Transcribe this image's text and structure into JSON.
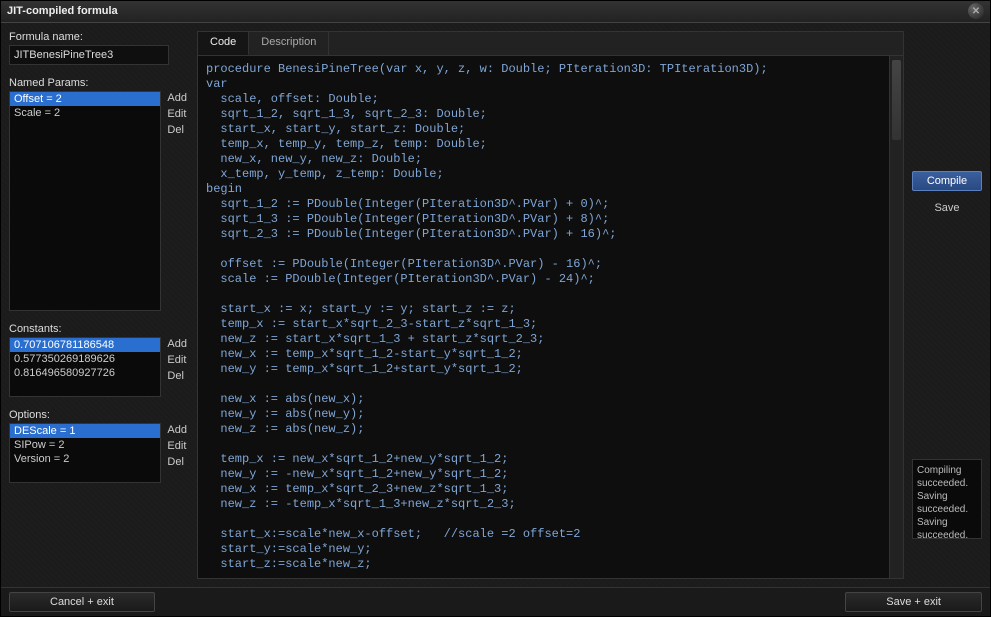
{
  "window": {
    "title": "JIT-compiled formula"
  },
  "formula": {
    "name_label": "Formula name:",
    "name_value": "JITBenesiPineTree3"
  },
  "params": {
    "label": "Named Params:",
    "items": [
      {
        "text": "Offset = 2",
        "selected": true
      },
      {
        "text": "Scale = 2",
        "selected": false
      }
    ],
    "add": "Add",
    "edit": "Edit",
    "del": "Del"
  },
  "constants": {
    "label": "Constants:",
    "items": [
      {
        "text": "0.707106781186548",
        "selected": true
      },
      {
        "text": "0.577350269189626",
        "selected": false
      },
      {
        "text": "0.816496580927726",
        "selected": false
      }
    ],
    "add": "Add",
    "edit": "Edit",
    "del": "Del"
  },
  "options": {
    "label": "Options:",
    "items": [
      {
        "text": "DEScale = 1",
        "selected": true
      },
      {
        "text": "SIPow = 2",
        "selected": false
      },
      {
        "text": "Version = 2",
        "selected": false
      }
    ],
    "add": "Add",
    "edit": "Edit",
    "del": "Del"
  },
  "tabs": {
    "code": "Code",
    "description": "Description"
  },
  "code": "procedure BenesiPineTree(var x, y, z, w: Double; PIteration3D: TPIteration3D);\nvar\n  scale, offset: Double;\n  sqrt_1_2, sqrt_1_3, sqrt_2_3: Double;\n  start_x, start_y, start_z: Double;\n  temp_x, temp_y, temp_z, temp: Double;\n  new_x, new_y, new_z: Double;\n  x_temp, y_temp, z_temp: Double;\nbegin\n  sqrt_1_2 := PDouble(Integer(PIteration3D^.PVar) + 0)^;\n  sqrt_1_3 := PDouble(Integer(PIteration3D^.PVar) + 8)^;\n  sqrt_2_3 := PDouble(Integer(PIteration3D^.PVar) + 16)^;\n\n  offset := PDouble(Integer(PIteration3D^.PVar) - 16)^;\n  scale := PDouble(Integer(PIteration3D^.PVar) - 24)^;\n\n  start_x := x; start_y := y; start_z := z;\n  temp_x := start_x*sqrt_2_3-start_z*sqrt_1_3;\n  new_z := start_x*sqrt_1_3 + start_z*sqrt_2_3;\n  new_x := temp_x*sqrt_1_2-start_y*sqrt_1_2;\n  new_y := temp_x*sqrt_1_2+start_y*sqrt_1_2;\n\n  new_x := abs(new_x);\n  new_y := abs(new_y);\n  new_z := abs(new_z);\n\n  temp_x := new_x*sqrt_1_2+new_y*sqrt_1_2;\n  new_y := -new_x*sqrt_1_2+new_y*sqrt_1_2;\n  new_x := temp_x*sqrt_2_3+new_z*sqrt_1_3;\n  new_z := -temp_x*sqrt_1_3+new_z*sqrt_2_3;\n\n  start_x:=scale*new_x-offset;   //scale =2 offset=2\n  start_y:=scale*new_y;\n  start_z:=scale*new_z;",
  "right": {
    "compile": "Compile",
    "save": "Save",
    "status": "Compiling succeeded.\nSaving succeeded.\nSaving succeeded."
  },
  "footer": {
    "cancel": "Cancel + exit",
    "save": "Save + exit"
  }
}
